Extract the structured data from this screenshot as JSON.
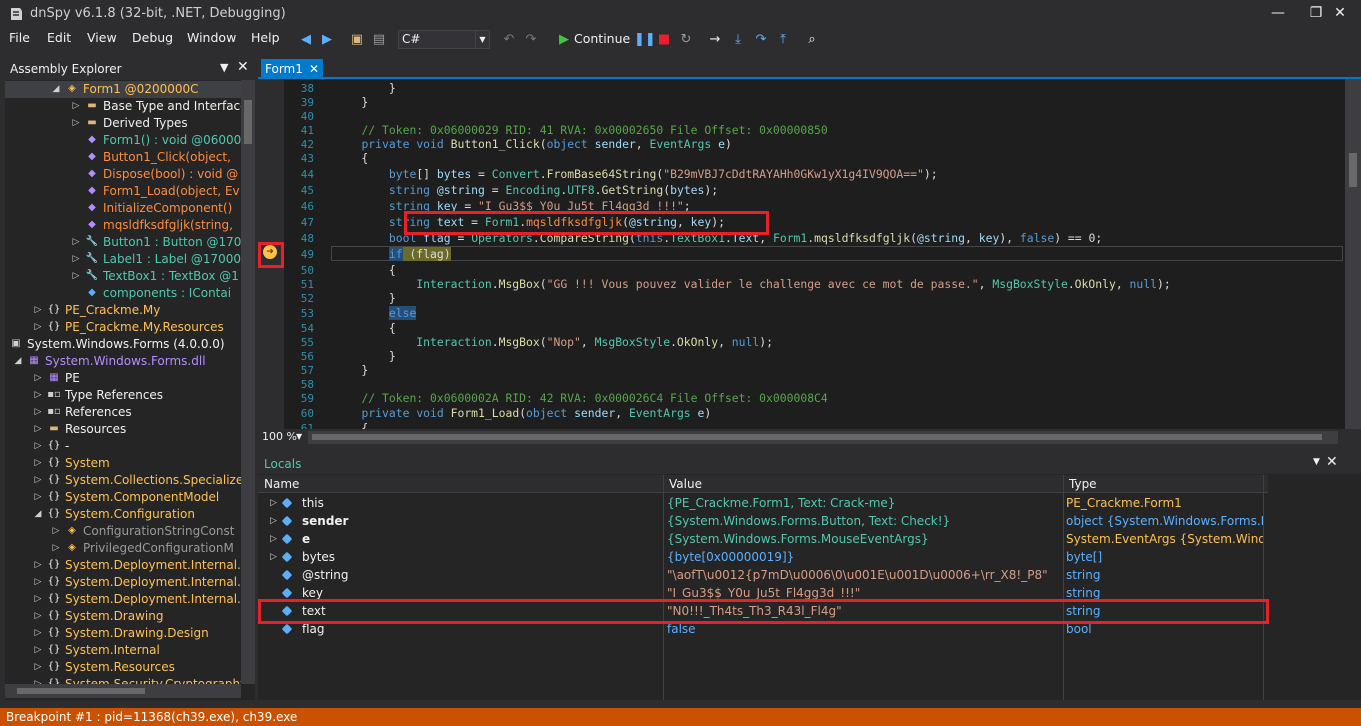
{
  "window": {
    "title": "dnSpy v6.1.8 (32-bit, .NET, Debugging)",
    "minimize": "—",
    "maximize": "❐",
    "close": "✕"
  },
  "menu": [
    "File",
    "Edit",
    "View",
    "Debug",
    "Window",
    "Help"
  ],
  "toolbar": {
    "language": "C#",
    "continue_label": "Continue"
  },
  "assembly_explorer": {
    "title": "Assembly Explorer",
    "items": [
      {
        "label": "Form1 @0200000C",
        "color": "yellow",
        "icon": "class-icon"
      },
      {
        "label": "Base Type and Interfaces",
        "color": "plain",
        "icon": "folder-icon"
      },
      {
        "label": "Derived Types",
        "color": "plain",
        "icon": "folder-icon"
      },
      {
        "label": "Form1() : void @06000",
        "color": "teal",
        "icon": "method-icon"
      },
      {
        "label": "Button1_Click(object, ",
        "color": "orange",
        "icon": "method-icon"
      },
      {
        "label": "Dispose(bool) : void @",
        "color": "orange",
        "icon": "method-icon"
      },
      {
        "label": "Form1_Load(object, Ev",
        "color": "orange",
        "icon": "method-icon"
      },
      {
        "label": "InitializeComponent()",
        "color": "orange",
        "icon": "method-icon"
      },
      {
        "label": "mqsldfksdfgljk(string, ",
        "color": "orange",
        "icon": "method-icon"
      },
      {
        "label": "Button1 : Button @170",
        "color": "teal",
        "icon": "property-icon"
      },
      {
        "label": "Label1 : Label @17000",
        "color": "teal",
        "icon": "property-icon"
      },
      {
        "label": "TextBox1 : TextBox @1",
        "color": "teal",
        "icon": "property-icon"
      },
      {
        "label": "components : IContai",
        "color": "teal",
        "icon": "field-icon"
      },
      {
        "label": "PE_Crackme.My",
        "color": "yellow",
        "icon": "namespace-icon"
      },
      {
        "label": "PE_Crackme.My.Resources",
        "color": "yellow",
        "icon": "namespace-icon"
      },
      {
        "label": "System.Windows.Forms (4.0.0.0)",
        "color": "plain",
        "icon": "assembly-icon"
      },
      {
        "label": "System.Windows.Forms.dll",
        "color": "purple",
        "icon": "module-icon"
      },
      {
        "label": "PE",
        "color": "plain",
        "icon": "pe-icon"
      },
      {
        "label": "Type References",
        "color": "plain",
        "icon": "references-icon"
      },
      {
        "label": "References",
        "color": "plain",
        "icon": "references-icon"
      },
      {
        "label": "Resources",
        "color": "plain",
        "icon": "folder-icon"
      },
      {
        "label": "-",
        "color": "plain",
        "icon": "namespace-icon"
      },
      {
        "label": "System",
        "color": "yellow",
        "icon": "namespace-icon"
      },
      {
        "label": "System.Collections.Specialized",
        "color": "yellow",
        "icon": "namespace-icon"
      },
      {
        "label": "System.ComponentModel",
        "color": "yellow",
        "icon": "namespace-icon"
      },
      {
        "label": "System.Configuration",
        "color": "yellow",
        "icon": "namespace-icon"
      },
      {
        "label": "ConfigurationStringConst",
        "color": "gray",
        "icon": "class-icon"
      },
      {
        "label": "PrivilegedConfigurationM",
        "color": "gray",
        "icon": "class-icon"
      },
      {
        "label": "System.Deployment.Internal.C",
        "color": "yellow",
        "icon": "namespace-icon"
      },
      {
        "label": "System.Deployment.Internal.I",
        "color": "yellow",
        "icon": "namespace-icon"
      },
      {
        "label": "System.Deployment.Internal.I",
        "color": "yellow",
        "icon": "namespace-icon"
      },
      {
        "label": "System.Drawing",
        "color": "yellow",
        "icon": "namespace-icon"
      },
      {
        "label": "System.Drawing.Design",
        "color": "yellow",
        "icon": "namespace-icon"
      },
      {
        "label": "System.Internal",
        "color": "yellow",
        "icon": "namespace-icon"
      },
      {
        "label": "System.Resources",
        "color": "yellow",
        "icon": "namespace-icon"
      },
      {
        "label": "System.Security.Cryptography",
        "color": "yellow",
        "icon": "namespace-icon"
      }
    ]
  },
  "editor": {
    "tab": "Form1",
    "zoom": "100 %",
    "line_numbers": [
      "38",
      "39",
      "40",
      "41",
      "42",
      "43",
      "44",
      "45",
      "46",
      "47",
      "48",
      "49",
      "50",
      "51",
      "52",
      "53",
      "54",
      "55",
      "56",
      "57",
      "58",
      "59",
      "60",
      "61"
    ]
  },
  "locals": {
    "title": "Locals",
    "columns": [
      "Name",
      "Value",
      "Type"
    ],
    "rows": [
      {
        "name": "this",
        "value": "{PE_Crackme.Form1, Text: Crack-me}",
        "type": "PE_Crackme.Form1",
        "expandable": true
      },
      {
        "name": "sender",
        "value": "{System.Windows.Forms.Button, Text: Check!}",
        "type": "object {System.Windows.Forms.B…",
        "expandable": true
      },
      {
        "name": "e",
        "value": "{System.Windows.Forms.MouseEventArgs}",
        "type": "System.EventArgs {System.Windo…",
        "expandable": true
      },
      {
        "name": "bytes",
        "value": "{byte[0x00000019]}",
        "type": "byte[]",
        "expandable": true
      },
      {
        "name": "@string",
        "value": "\"\\aofT\\u0012{p7mD\\u0006\\0\\u001E\\u001D\\u0006+\\rr_X8!_P8\"",
        "type": "string",
        "expandable": false
      },
      {
        "name": "key",
        "value": "\"I_Gu3$$_Y0u_Ju5t_Fl4gg3d_!!!\"",
        "type": "string",
        "expandable": false
      },
      {
        "name": "text",
        "value": "\"N0!!!_Th4ts_Th3_R43l_Fl4g\"",
        "type": "string",
        "expandable": false
      },
      {
        "name": "flag",
        "value": "false",
        "type": "bool",
        "expandable": false
      }
    ]
  },
  "statusbar": {
    "text": "Breakpoint #1 : pid=11368(ch39.exe), ch39.exe"
  },
  "colors": {
    "accent": "#007acc",
    "status": "#ca5100",
    "annotation": "#e8202a"
  }
}
